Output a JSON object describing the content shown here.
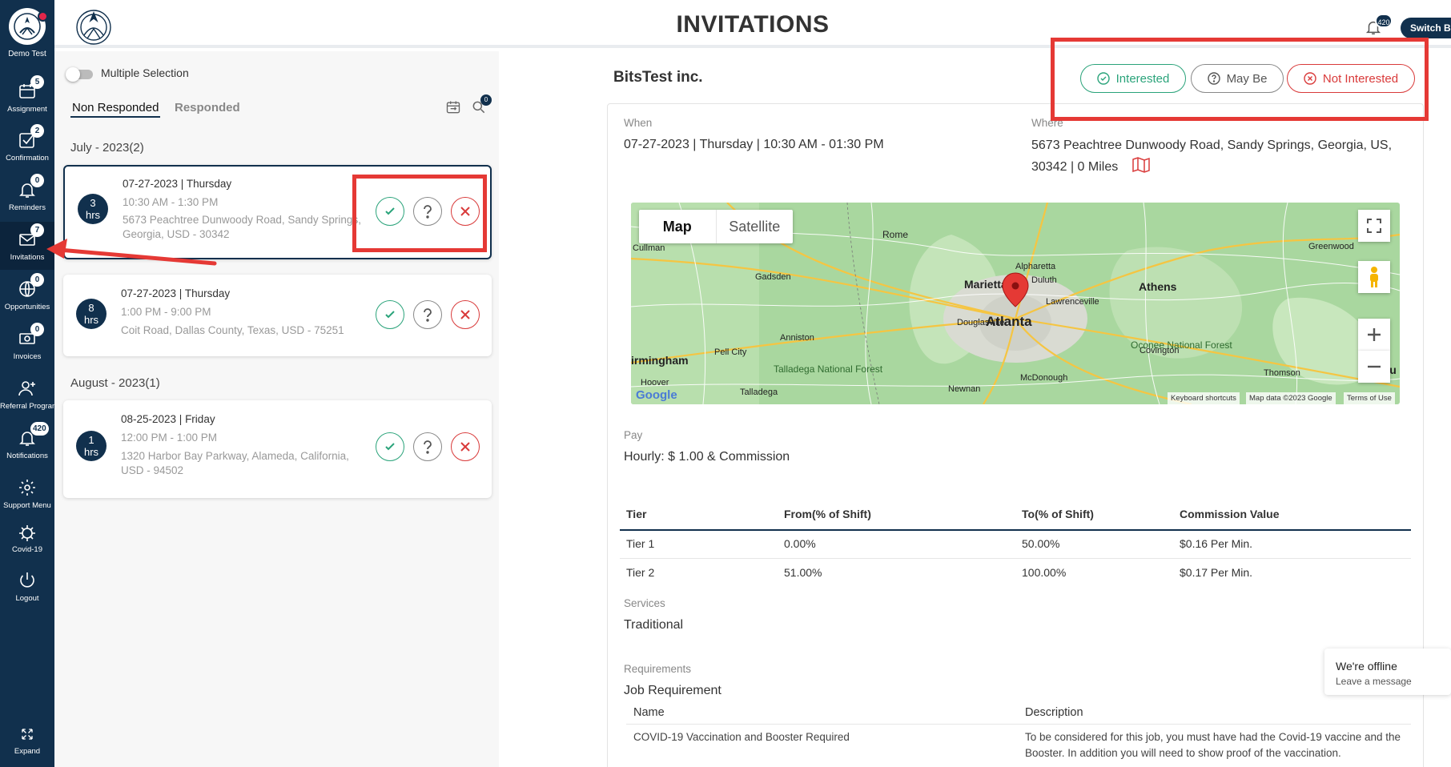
{
  "brand": {
    "name": "Demo Test"
  },
  "sidebar": {
    "items": [
      {
        "label": "Assignment",
        "badge": "5"
      },
      {
        "label": "Confirmation",
        "badge": "2"
      },
      {
        "label": "Reminders",
        "badge": "0"
      },
      {
        "label": "Invitations",
        "badge": "7"
      },
      {
        "label": "Opportunities",
        "badge": "0"
      },
      {
        "label": "Invoices",
        "badge": "0"
      },
      {
        "label": "Referral Program",
        "badge": ""
      },
      {
        "label": "Notifications",
        "badge": "420"
      },
      {
        "label": "Support Menu",
        "badge": ""
      },
      {
        "label": "Covid-19",
        "badge": ""
      },
      {
        "label": "Logout",
        "badge": ""
      }
    ],
    "expand_label": "Expand"
  },
  "header": {
    "title": "INVITATIONS",
    "notif_count": "420",
    "switch_label": "Switch Back"
  },
  "left": {
    "multi_label": "Multiple Selection",
    "tabs": [
      "Non Responded",
      "Responded"
    ],
    "search_count": "0",
    "groups": [
      {
        "title": "July - 2023(2)"
      },
      {
        "title": "August - 2023(1)"
      }
    ],
    "cards": [
      {
        "hrs": "3",
        "hrs_unit": "hrs",
        "date": "07-27-2023 | Thursday",
        "time": "10:30 AM - 1:30 PM",
        "address": "5673 Peachtree Dunwoody Road, Sandy Springs, Georgia, USD - 30342"
      },
      {
        "hrs": "8",
        "hrs_unit": "hrs",
        "date": "07-27-2023 | Thursday",
        "time": "1:00 PM - 9:00 PM",
        "address": "Coit Road, Dallas County, Texas, USD - 75251"
      },
      {
        "hrs": "1",
        "hrs_unit": "hrs",
        "date": "08-25-2023 | Friday",
        "time": "12:00 PM - 1:00 PM",
        "address": "1320 Harbor Bay Parkway, Alameda, California, USD - 94502"
      }
    ]
  },
  "detail": {
    "company": "BitsTest inc.",
    "buttons": {
      "interested": "Interested",
      "maybe": "May Be",
      "not_interested": "Not Interested"
    },
    "when_label": "When",
    "when_value": "07-27-2023 | Thursday | 10:30 AM - 01:30 PM",
    "where_label": "Where",
    "where_value": "5673 Peachtree Dunwoody Road, Sandy Springs, Georgia, US, 30342 | 0  Miles",
    "map": {
      "tabs": [
        "Map",
        "Satellite"
      ],
      "cities": [
        "Rome",
        "Cullman",
        "Gadsden",
        "Marietta",
        "Duluth",
        "Alpharetta",
        "Lawrenceville",
        "Athens",
        "Greenwood",
        "Douglasville",
        "Atlanta",
        "Anniston",
        "Pell City",
        "irmingham",
        "Hoover",
        "Talladega",
        "Talladega National Forest",
        "Newnan",
        "McDonough",
        "Covington",
        "Oconee National Forest",
        "Thomson",
        "Augu"
      ],
      "attribution": [
        "Keyboard shortcuts",
        "Map data ©2023 Google",
        "Terms of Use"
      ],
      "google": "Google"
    },
    "pay_label": "Pay",
    "pay_value": "Hourly: $ 1.00 & Commission",
    "tiers": {
      "headers": [
        "Tier",
        "From(% of Shift)",
        "To(% of Shift)",
        "Commission Value"
      ],
      "rows": [
        [
          "Tier 1",
          "0.00%",
          "50.00%",
          "$0.16 Per Min."
        ],
        [
          "Tier 2",
          "51.00%",
          "100.00%",
          "$0.17 Per Min."
        ]
      ]
    },
    "services_label": "Services",
    "services_value": "Traditional",
    "requirements_label": "Requirements",
    "job_req_title": "Job Requirement",
    "req_headers": [
      "Name",
      "Description"
    ],
    "req_rows": [
      [
        "COVID-19 Vaccination and Booster Required",
        "To be considered for this job, you must have had the Covid-19 vaccine and the Booster. In addition you will need to show proof of the vaccination."
      ]
    ]
  },
  "chat": {
    "title": "We're offline",
    "subtitle": "Leave a message"
  },
  "colors": {
    "navy": "#11304d",
    "green": "#2aa37a",
    "red": "#d93a3a",
    "annotation": "#e53935"
  }
}
